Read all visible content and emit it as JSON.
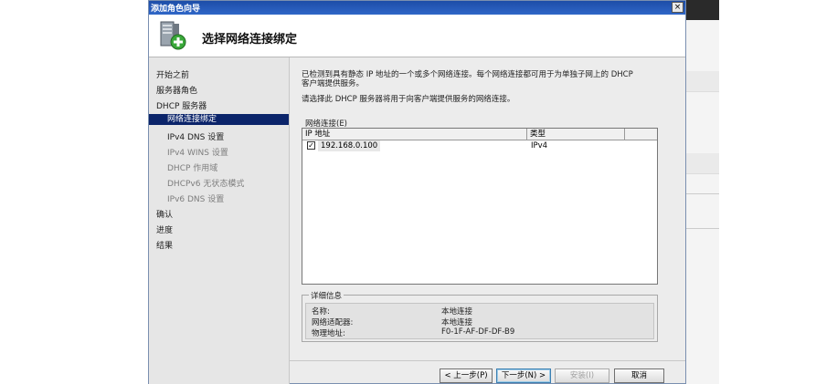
{
  "window": {
    "title": "添加角色向导",
    "close_glyph": "×",
    "header_title": "选择网络连接绑定",
    "header_icon": "server-role-add-icon"
  },
  "nav": {
    "items": [
      {
        "label": "开始之前",
        "state": "normal"
      },
      {
        "label": "服务器角色",
        "state": "normal"
      },
      {
        "label": "DHCP 服务器",
        "state": "normal"
      },
      {
        "label": "网络连接绑定",
        "state": "selected"
      },
      {
        "label": "IPv4 DNS 设置",
        "state": "sub"
      },
      {
        "label": "IPv4 WINS 设置",
        "state": "dim"
      },
      {
        "label": "DHCP 作用域",
        "state": "dim"
      },
      {
        "label": "DHCPv6 无状态模式",
        "state": "dim"
      },
      {
        "label": "IPv6 DNS 设置",
        "state": "dim"
      },
      {
        "label": "确认",
        "state": "normal"
      },
      {
        "label": "进度",
        "state": "normal"
      },
      {
        "label": "结果",
        "state": "normal"
      }
    ]
  },
  "content": {
    "desc1_line1": "已检测到具有静态 IP 地址的一个或多个网络连接。每个网络连接都可用于为单独子网上的 DHCP",
    "desc1_line2": "客户端提供服务。",
    "desc2": "请选择此 DHCP 服务器将用于向客户端提供服务的网络连接。",
    "connections_label": "网络连接(E)",
    "columns": [
      "IP 地址",
      "类型"
    ],
    "rows": [
      {
        "checked": true,
        "check_glyph": "✓",
        "ip": "192.168.0.100",
        "type": "IPv4"
      }
    ],
    "details": {
      "legend": "详细信息",
      "items": [
        {
          "label": "名称:",
          "value": "本地连接"
        },
        {
          "label": "网络适配器:",
          "value": "本地连接"
        },
        {
          "label": "物理地址:",
          "value": "F0-1F-AF-DF-DF-B9"
        }
      ]
    }
  },
  "buttons": {
    "back": "< 上一步(P)",
    "next": "下一步(N) >",
    "install": "安装(I)",
    "cancel": "取消"
  }
}
